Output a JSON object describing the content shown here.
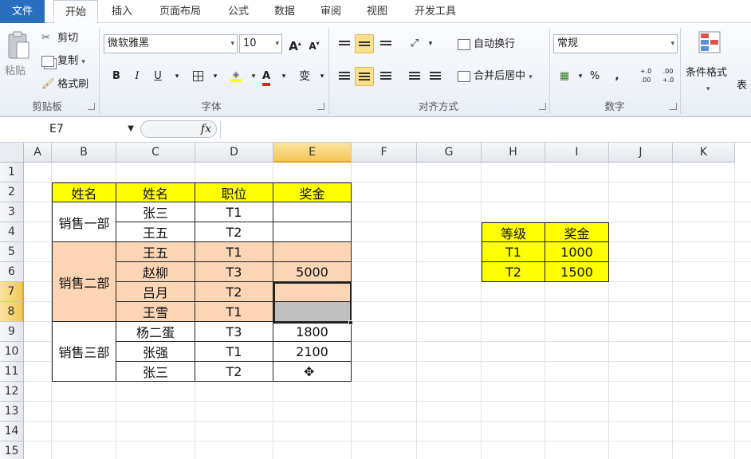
{
  "ribbon_tabs": [
    "文件",
    "开始",
    "插入",
    "页面布局",
    "公式",
    "数据",
    "审阅",
    "视图",
    "开发工具"
  ],
  "active_tab": "开始",
  "clipboard": {
    "paste": "粘贴",
    "cut": "剪切",
    "copy": "复制",
    "format_painter": "格式刷",
    "group": "剪贴板"
  },
  "font": {
    "name": "微软雅黑",
    "size": "10",
    "grow": "A",
    "shrink": "A",
    "bold": "B",
    "italic": "I",
    "underline": "U",
    "color_letter": "A",
    "phonetic": "变",
    "group": "字体"
  },
  "alignment": {
    "wrap": "自动换行",
    "merge": "合并后居中",
    "group": "对齐方式"
  },
  "number": {
    "format": "常规",
    "percent": "%",
    "comma": ",",
    "inc_decimal": "+.0 .00",
    "dec_decimal": ".00 +.0",
    "group": "数字"
  },
  "styles": {
    "conditional": "条件格式",
    "table_partial": "表"
  },
  "formula_bar": {
    "name_box": "E7",
    "fx": "fx",
    "value": ""
  },
  "columns": [
    "A",
    "B",
    "C",
    "D",
    "E",
    "F",
    "G",
    "H",
    "I",
    "J",
    "K"
  ],
  "selected_column": "E",
  "rows": [
    "1",
    "2",
    "3",
    "4",
    "5",
    "6",
    "7",
    "8",
    "9",
    "10",
    "11",
    "12",
    "13",
    "14",
    "15"
  ],
  "selected_rows": [
    "7",
    "8"
  ],
  "main_table": {
    "headers": [
      "姓名",
      "姓名",
      "职位",
      "奖金"
    ],
    "departments": [
      "销售一部",
      "销售二部",
      "销售三部"
    ],
    "names": [
      "张三",
      "王五",
      "王五",
      "赵柳",
      "吕月",
      "王雪",
      "杨二蛋",
      "张强",
      "张三"
    ],
    "positions": [
      "T1",
      "T2",
      "T1",
      "T3",
      "T2",
      "T1",
      "T3",
      "T1",
      "T2"
    ],
    "bonus": [
      "",
      "",
      "",
      "5000",
      "",
      "",
      "1800",
      "2100",
      ""
    ]
  },
  "lookup_table": {
    "headers": [
      "等级",
      "奖金"
    ],
    "rows": [
      [
        "T1",
        "1000"
      ],
      [
        "T2",
        "1500"
      ]
    ]
  },
  "colors": {
    "yellow": "#ffff00",
    "peach": "#fcd5b4",
    "gray": "#bfbfbf",
    "file_tab": "#2a6fbf",
    "font_red": "#e02020"
  }
}
